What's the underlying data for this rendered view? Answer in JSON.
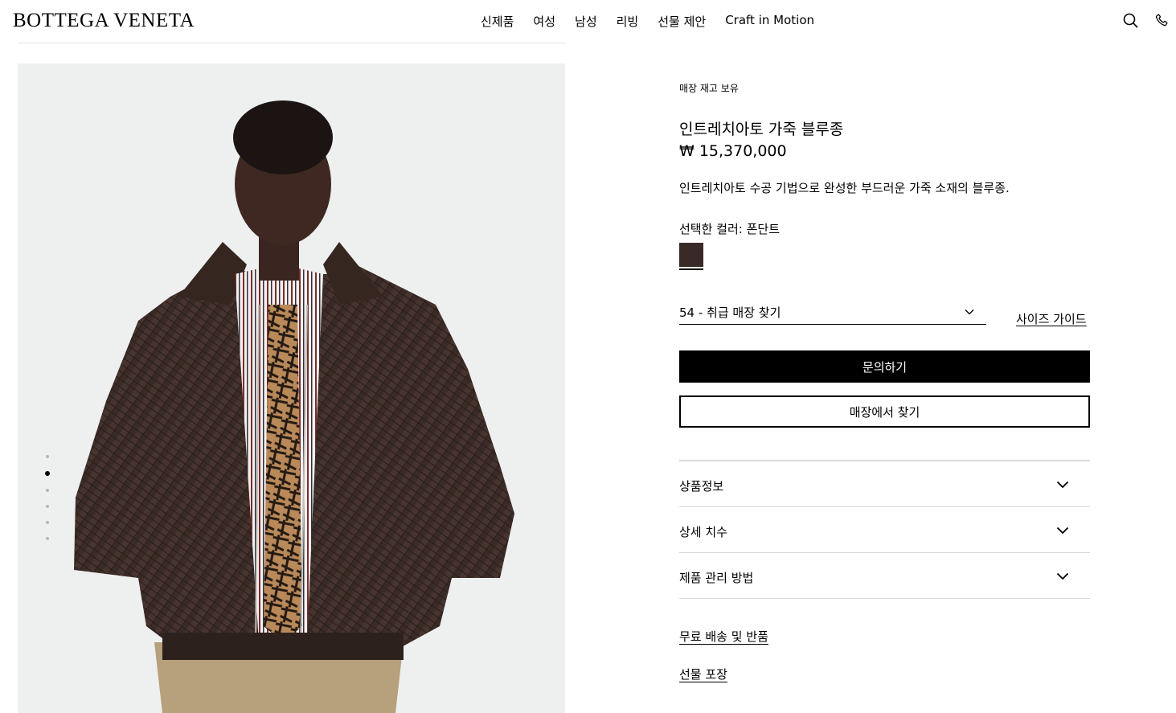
{
  "brand": {
    "logo": "BOTTEGA VENETA"
  },
  "nav": {
    "items": [
      {
        "label": "신제품"
      },
      {
        "label": "여성"
      },
      {
        "label": "남성"
      },
      {
        "label": "리빙"
      },
      {
        "label": "선물 제안"
      },
      {
        "label": "Craft in Motion"
      }
    ]
  },
  "header_icons": [
    "search-icon",
    "phone-icon"
  ],
  "gallery": {
    "image": "male model wearing dark brown woven leather bomber jacket with striped shirt and patterned tie",
    "dot_count": 6,
    "active_dot": 1
  },
  "product": {
    "stock_status": "매장 재고 보유",
    "name": "인트레치아토 가죽 블루종",
    "price": "₩ 15,370,000",
    "description": "인트레치아토 수공 기법으로 완성한 부드러운 가죽 소재의 블루종.",
    "color_label": "선택한 컬러: 폰단트",
    "swatch_color": "#3a2a27",
    "size_value": "54 - 취급 매장 찾기",
    "size_guide": "사이즈 가이드",
    "primary_button": "문의하기",
    "secondary_button": "매장에서 찾기"
  },
  "accordion": [
    {
      "label": "상품정보"
    },
    {
      "label": "상세 치수"
    },
    {
      "label": "제품 관리 방법"
    }
  ],
  "links": {
    "shipping": "무료 배송 및 반품",
    "gift": "선물 포장"
  },
  "colors": {
    "gallery_bg": "#eef0ef",
    "jacket": "#3a2a27",
    "divider": "#d9d9d9"
  }
}
